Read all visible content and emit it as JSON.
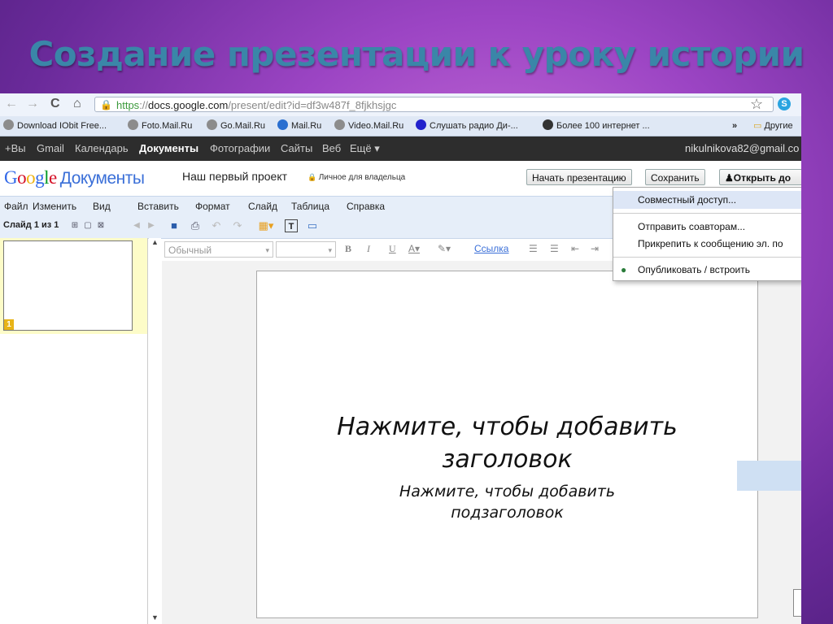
{
  "slide_title": "Создание презентации к уроку истории",
  "browser": {
    "url_scheme": "https",
    "url_sep": "://",
    "url_host": "docs.google.com",
    "url_path": "/present/edit?id=df3w487f_8fjkhsjgc"
  },
  "bookmarks": [
    {
      "label": "Download IObit Free...",
      "color": "#8c8c8c"
    },
    {
      "label": "Foto.Mail.Ru",
      "color": "#8c8c8c"
    },
    {
      "label": "Go.Mail.Ru",
      "color": "#8c8c8c"
    },
    {
      "label": "Mail.Ru",
      "color": "#2a6fd0"
    },
    {
      "label": "Video.Mail.Ru",
      "color": "#8c8c8c"
    },
    {
      "label": "Слушать радио Ди-...",
      "color": "#2222cc"
    },
    {
      "label": "Более 100 интернет ...",
      "color": "#333333"
    }
  ],
  "bookmarks_more": "»",
  "bookmarks_other": "Другие",
  "gbar": {
    "items": [
      "+Вы",
      "Gmail",
      "Календарь",
      "Документы",
      "Фотографии",
      "Сайты",
      "Веб",
      "Ещё ▾"
    ],
    "email": "nikulnikova82@gmail.co"
  },
  "header": {
    "logo_letters": [
      "G",
      "o",
      "o",
      "g",
      "l",
      "e"
    ],
    "logo_colors": [
      "#3369e8",
      "#d50f25",
      "#eeb211",
      "#3369e8",
      "#009925",
      "#d50f25"
    ],
    "logo_docs": "Документы",
    "doc_title": "Наш первый проект",
    "privacy": "Личное для владельца",
    "start_btn": "Начать презентацию",
    "save_btn": "Сохранить",
    "share_btn": "Открыть до"
  },
  "menu": [
    "Файл",
    "Изменить",
    "Вид",
    "Вставить",
    "Формат",
    "Слайд",
    "Таблица",
    "Справка"
  ],
  "toolbar": {
    "slide_count": "Слайд 1 из 1",
    "style_select": "Обычный",
    "link": "Ссылка"
  },
  "sidebar": {
    "slide_number": "1"
  },
  "slide": {
    "title_placeholder_1": "Нажмите, чтобы добавить",
    "title_placeholder_2": "заголовок",
    "subtitle_placeholder_1": "Нажмите, чтобы добавить",
    "subtitle_placeholder_2": "подзаголовок"
  },
  "share_menu": {
    "collab": "Совместный доступ...",
    "send": "Отправить соавторам...",
    "attach": "Прикрепить к сообщению эл. по",
    "publish": "Опубликовать / встроить"
  }
}
